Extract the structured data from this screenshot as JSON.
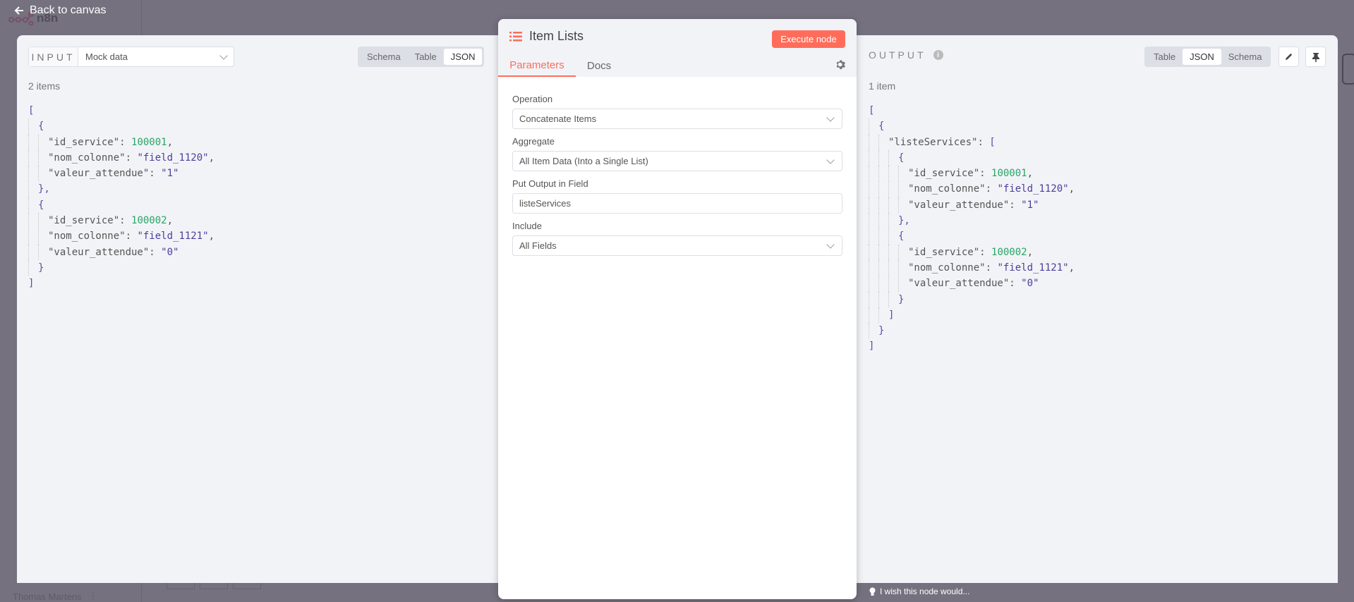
{
  "nav": {
    "back_label": "Back to canvas",
    "logo_text": "n8n",
    "user_name": "Thomas Martens"
  },
  "input": {
    "label": "INPUT",
    "source": "Mock data",
    "tabs": [
      "Schema",
      "Table",
      "JSON"
    ],
    "active_tab": "JSON",
    "count": "2 items",
    "lines": [
      {
        "d": 0,
        "o": "["
      },
      {
        "d": 1,
        "o": "{"
      },
      {
        "d": 2,
        "k": "\"id_service\"",
        "v": "100001",
        "t": "num",
        "p": ","
      },
      {
        "d": 2,
        "k": "\"nom_colonne\"",
        "v": "\"field_1120\"",
        "t": "str",
        "p": ","
      },
      {
        "d": 2,
        "k": "\"valeur_attendue\"",
        "v": "\"1\"",
        "t": "str",
        "p": ""
      },
      {
        "d": 1,
        "o": "},"
      },
      {
        "d": 1,
        "o": "{"
      },
      {
        "d": 2,
        "k": "\"id_service\"",
        "v": "100002",
        "t": "num",
        "p": ","
      },
      {
        "d": 2,
        "k": "\"nom_colonne\"",
        "v": "\"field_1121\"",
        "t": "str",
        "p": ","
      },
      {
        "d": 2,
        "k": "\"valeur_attendue\"",
        "v": "\"0\"",
        "t": "str",
        "p": ""
      },
      {
        "d": 1,
        "o": "}"
      },
      {
        "d": 0,
        "o": "]"
      }
    ]
  },
  "node": {
    "title": "Item Lists",
    "execute_label": "Execute node",
    "tabs": [
      "Parameters",
      "Docs"
    ],
    "active_tab": "Parameters",
    "fields": [
      {
        "label": "Operation",
        "value": "Concatenate Items",
        "kind": "select"
      },
      {
        "label": "Aggregate",
        "value": "All Item Data (Into a Single List)",
        "kind": "select"
      },
      {
        "label": "Put Output in Field",
        "value": "listeServices",
        "kind": "input"
      },
      {
        "label": "Include",
        "value": "All Fields",
        "kind": "select"
      }
    ],
    "accent": "#ff6d5a"
  },
  "output": {
    "label": "OUTPUT",
    "tabs": [
      "Table",
      "JSON",
      "Schema"
    ],
    "active_tab": "JSON",
    "count": "1 item",
    "lines": [
      {
        "d": 0,
        "o": "["
      },
      {
        "d": 1,
        "o": "{"
      },
      {
        "d": 2,
        "k": "\"listeServices\"",
        "v": "[",
        "t": "br",
        "p": ""
      },
      {
        "d": 3,
        "o": "{"
      },
      {
        "d": 4,
        "k": "\"id_service\"",
        "v": "100001",
        "t": "num",
        "p": ","
      },
      {
        "d": 4,
        "k": "\"nom_colonne\"",
        "v": "\"field_1120\"",
        "t": "str",
        "p": ","
      },
      {
        "d": 4,
        "k": "\"valeur_attendue\"",
        "v": "\"1\"",
        "t": "str",
        "p": ""
      },
      {
        "d": 3,
        "o": "},"
      },
      {
        "d": 3,
        "o": "{"
      },
      {
        "d": 4,
        "k": "\"id_service\"",
        "v": "100002",
        "t": "num",
        "p": ","
      },
      {
        "d": 4,
        "k": "\"nom_colonne\"",
        "v": "\"field_1121\"",
        "t": "str",
        "p": ","
      },
      {
        "d": 4,
        "k": "\"valeur_attendue\"",
        "v": "\"0\"",
        "t": "str",
        "p": ""
      },
      {
        "d": 3,
        "o": "}"
      },
      {
        "d": 2,
        "o": "]"
      },
      {
        "d": 1,
        "o": "}"
      },
      {
        "d": 0,
        "o": "]"
      }
    ]
  },
  "footer": {
    "hint": "I wish this node would..."
  }
}
